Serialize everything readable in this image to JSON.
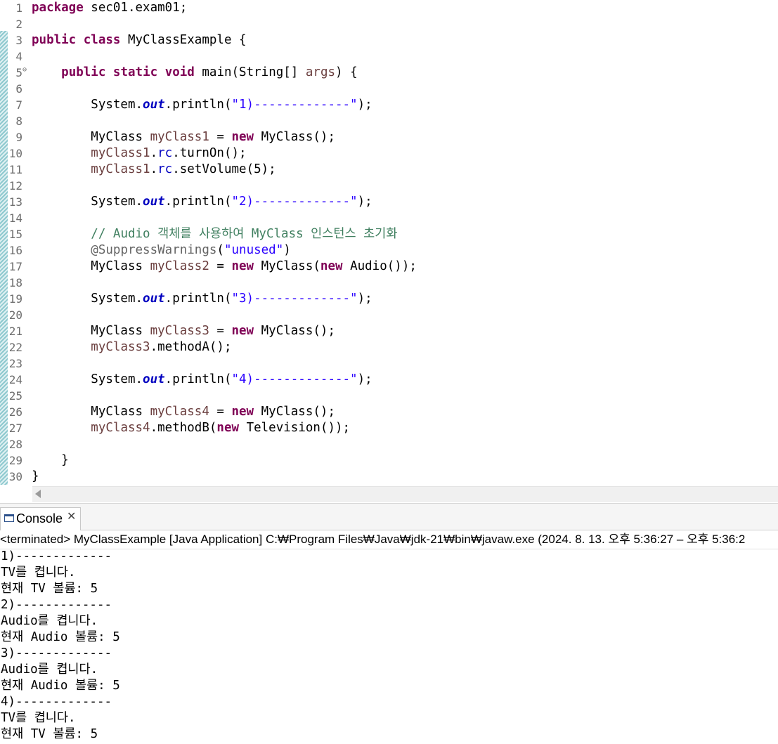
{
  "editor": {
    "lines": [
      {
        "n": "1",
        "html": "<span class=\"kw\">package</span> sec01.exam01;"
      },
      {
        "n": "2",
        "html": ""
      },
      {
        "n": "3",
        "html": "<span class=\"kw\">public</span> <span class=\"kw\">class</span> MyClassExample {"
      },
      {
        "n": "4",
        "html": ""
      },
      {
        "n": "5",
        "fold": "⊖",
        "html": "    <span class=\"kw\">public</span> <span class=\"kw\">static</span> <span class=\"kw\">void</span> main(String[] <span class=\"var\">args</span>) {"
      },
      {
        "n": "6",
        "html": ""
      },
      {
        "n": "7",
        "html": "        System.<span class=\"sfld\">out</span>.println(<span class=\"str\">\"1)-------------\"</span>);"
      },
      {
        "n": "8",
        "html": ""
      },
      {
        "n": "9",
        "html": "        MyClass <span class=\"var\">myClass1</span> = <span class=\"kw\">new</span> MyClass();"
      },
      {
        "n": "10",
        "html": "        <span class=\"var\">myClass1</span>.<span class=\"fld\">rc</span>.turnOn();"
      },
      {
        "n": "11",
        "html": "        <span class=\"var\">myClass1</span>.<span class=\"fld\">rc</span>.setVolume(5);"
      },
      {
        "n": "12",
        "html": ""
      },
      {
        "n": "13",
        "html": "        System.<span class=\"sfld\">out</span>.println(<span class=\"str\">\"2)-------------\"</span>);"
      },
      {
        "n": "14",
        "html": ""
      },
      {
        "n": "15",
        "html": "        <span class=\"cmt\">// Audio 객체를 사용하여 MyClass 인스턴스 초기화</span>"
      },
      {
        "n": "16",
        "html": "        <span class=\"ann\">@SuppressWarnings</span>(<span class=\"str\">\"unused\"</span>)"
      },
      {
        "n": "17",
        "html": "        MyClass <span class=\"var\">myClass2</span> = <span class=\"kw\">new</span> MyClass(<span class=\"kw\">new</span> Audio());"
      },
      {
        "n": "18",
        "html": ""
      },
      {
        "n": "19",
        "html": "        System.<span class=\"sfld\">out</span>.println(<span class=\"str\">\"3)-------------\"</span>);"
      },
      {
        "n": "20",
        "html": ""
      },
      {
        "n": "21",
        "html": "        MyClass <span class=\"var\">myClass3</span> = <span class=\"kw\">new</span> MyClass();"
      },
      {
        "n": "22",
        "html": "        <span class=\"var\">myClass3</span>.methodA();"
      },
      {
        "n": "23",
        "html": ""
      },
      {
        "n": "24",
        "html": "        System.<span class=\"sfld\">out</span>.println(<span class=\"str\">\"4)-------------\"</span>);"
      },
      {
        "n": "25",
        "html": ""
      },
      {
        "n": "26",
        "html": "        MyClass <span class=\"var\">myClass4</span> = <span class=\"kw\">new</span> MyClass();"
      },
      {
        "n": "27",
        "html": "        <span class=\"var\">myClass4</span>.methodB(<span class=\"kw\">new</span> Television());"
      },
      {
        "n": "28",
        "html": ""
      },
      {
        "n": "29",
        "html": "    }"
      },
      {
        "n": "30",
        "html": "}"
      }
    ]
  },
  "colors": {
    "keyword": "#7f0055",
    "local_variable": "#6a3e3e",
    "field": "#0000c0",
    "string": "#2a00ff",
    "comment": "#3f7f5f",
    "annotation": "#646464"
  },
  "console": {
    "tab_label": "Console",
    "tab_icon": "console-icon",
    "close_glyph": "✕",
    "status": "<terminated> MyClassExample [Java Application] C:₩Program Files₩Java₩jdk-21₩bin₩javaw.exe  (2024. 8. 13. 오후 5:36:27 – 오후 5:36:2",
    "output": [
      "1)-------------",
      "TV를 켭니다.",
      "현재 TV 볼륨: 5",
      "2)-------------",
      "Audio를 켭니다.",
      "현재 Audio 볼륨: 5",
      "3)-------------",
      "Audio를 켭니다.",
      "현재 Audio 볼륨: 5",
      "4)-------------",
      "TV를 켭니다.",
      "현재 TV 볼륨: 5"
    ]
  }
}
